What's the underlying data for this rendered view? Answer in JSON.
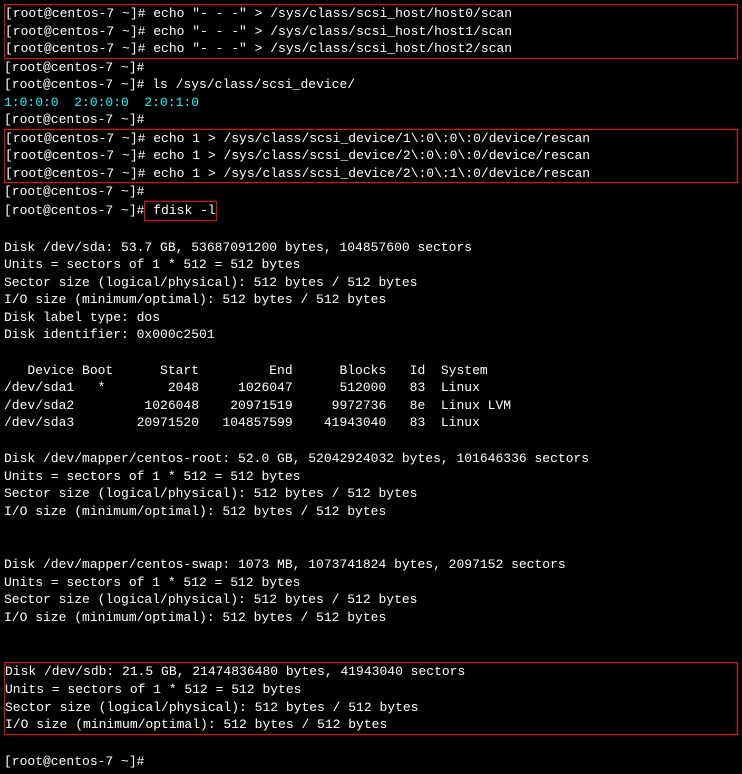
{
  "prompt": "[root@centos-7 ~]#",
  "cmd": {
    "scan0": " echo \"- - -\" > /sys/class/scsi_host/host0/scan",
    "scan1": " echo \"- - -\" > /sys/class/scsi_host/host1/scan",
    "scan2": " echo \"- - -\" > /sys/class/scsi_host/host2/scan",
    "ls": " ls /sys/class/scsi_device/",
    "rescan0": " echo 1 > /sys/class/scsi_device/1\\:0\\:0\\:0/device/rescan",
    "rescan1": " echo 1 > /sys/class/scsi_device/2\\:0\\:0\\:0/device/rescan",
    "rescan2": " echo 1 > /sys/class/scsi_device/2\\:0\\:1\\:0/device/rescan",
    "fdisk": " fdisk -l"
  },
  "ls_output": "1:0:0:0  2:0:0:0  2:0:1:0",
  "disk_sda": {
    "l1": "Disk /dev/sda: 53.7 GB, 53687091200 bytes, 104857600 sectors",
    "l2": "Units = sectors of 1 * 512 = 512 bytes",
    "l3": "Sector size (logical/physical): 512 bytes / 512 bytes",
    "l4": "I/O size (minimum/optimal): 512 bytes / 512 bytes",
    "l5": "Disk label type: dos",
    "l6": "Disk identifier: 0x000c2501"
  },
  "part_header": "   Device Boot      Start         End      Blocks   Id  System",
  "partitions": [
    "/dev/sda1   *        2048     1026047      512000   83  Linux",
    "/dev/sda2         1026048    20971519     9972736   8e  Linux LVM",
    "/dev/sda3        20971520   104857599    41943040   83  Linux"
  ],
  "disk_root": {
    "l1": "Disk /dev/mapper/centos-root: 52.0 GB, 52042924032 bytes, 101646336 sectors",
    "l2": "Units = sectors of 1 * 512 = 512 bytes",
    "l3": "Sector size (logical/physical): 512 bytes / 512 bytes",
    "l4": "I/O size (minimum/optimal): 512 bytes / 512 bytes"
  },
  "disk_swap": {
    "l1": "Disk /dev/mapper/centos-swap: 1073 MB, 1073741824 bytes, 2097152 sectors",
    "l2": "Units = sectors of 1 * 512 = 512 bytes",
    "l3": "Sector size (logical/physical): 512 bytes / 512 bytes",
    "l4": "I/O size (minimum/optimal): 512 bytes / 512 bytes"
  },
  "disk_sdb": {
    "l1": "Disk /dev/sdb: 21.5 GB, 21474836480 bytes, 41943040 sectors",
    "l2": "Units = sectors of 1 * 512 = 512 bytes",
    "l3": "Sector size (logical/physical): 512 bytes / 512 bytes",
    "l4": "I/O size (minimum/optimal): 512 bytes / 512 bytes"
  }
}
